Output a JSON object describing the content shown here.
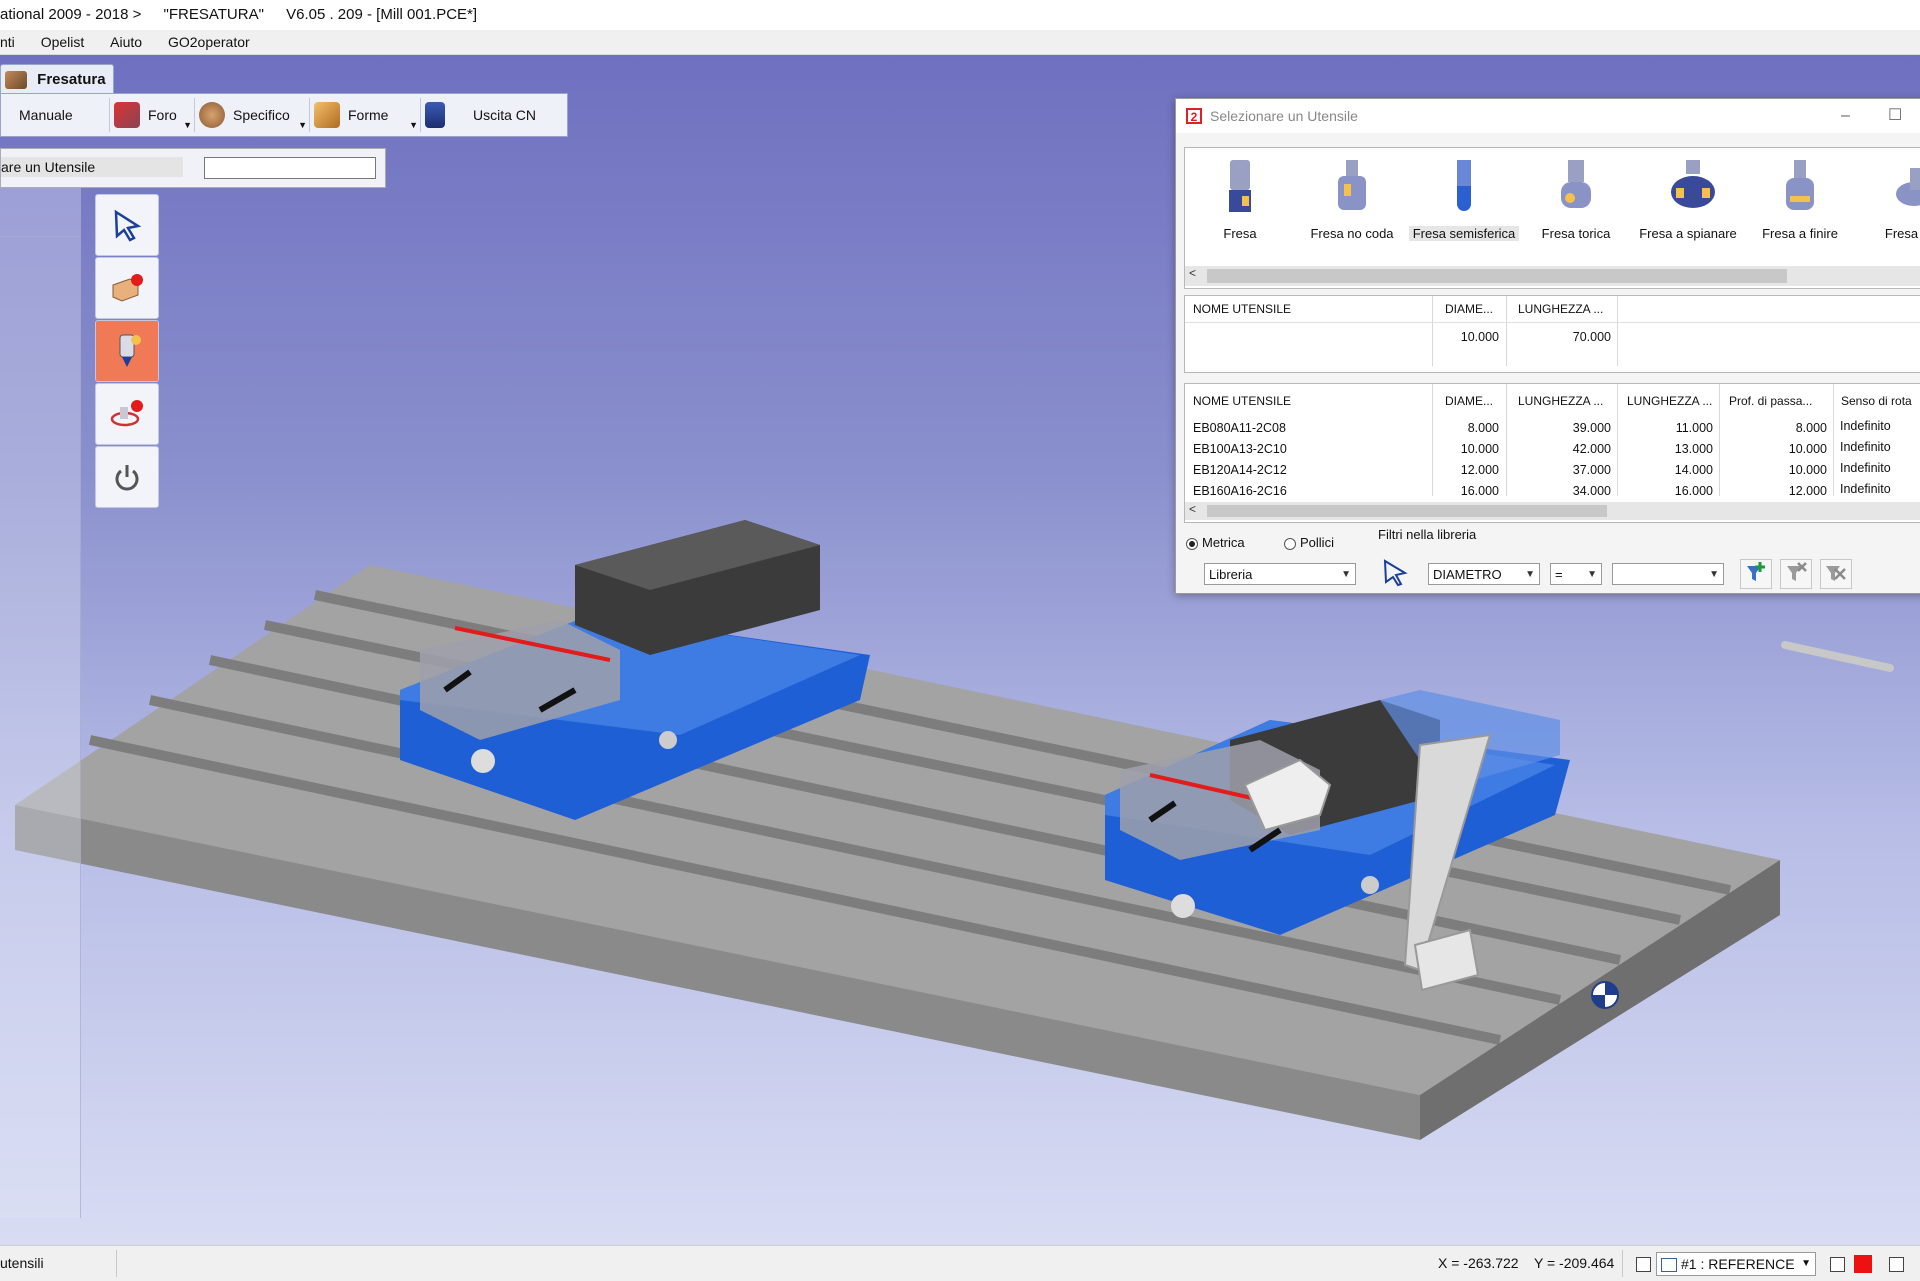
{
  "window": {
    "title_parts": [
      "ational 2009 - 2018 >",
      "\"FRESATURA\"",
      "V6.05 . 209 - [Mill 001.PCE*]"
    ]
  },
  "menu": [
    "nti",
    "Opelist",
    "Aiuto",
    "GO2operator"
  ],
  "module_tab": {
    "label": "Fresatura"
  },
  "ribbon": [
    {
      "label": "Manuale",
      "icon": "manual-icon"
    },
    {
      "label": "Foro",
      "icon": "drill-icon"
    },
    {
      "label": "Specifico",
      "icon": "specific-icon"
    },
    {
      "label": "Forme",
      "icon": "shapes-icon"
    },
    {
      "label": "Uscita CN",
      "icon": "nc-output-icon"
    }
  ],
  "utensile_strip": {
    "label": "are un Utensile",
    "value": ""
  },
  "side_tools": [
    "select-arrow-icon",
    "workpiece-icon",
    "tool-icon",
    "toolpath-icon",
    "power-icon"
  ],
  "dialog": {
    "title": "Selezionare un Utensile",
    "tool_types": [
      "Fresa",
      "Fresa no coda",
      "Fresa semisferica",
      "Fresa torica",
      "Fresa a spianare",
      "Fresa a finire",
      "Fresa a c"
    ],
    "selected_tool_type": "Fresa semisferica",
    "filter_grid": {
      "headers": [
        "NOME UTENSILE",
        "DIAME...",
        "LUNGHEZZA ..."
      ],
      "row": [
        "",
        "10.000",
        "70.000"
      ]
    },
    "tools_grid": {
      "headers": [
        "NOME UTENSILE",
        "DIAME...",
        "LUNGHEZZA ...",
        "LUNGHEZZA ...",
        "Prof. di passa...",
        "Senso di rota"
      ],
      "rows": [
        [
          "EB080A11-2C08",
          "8.000",
          "39.000",
          "11.000",
          "8.000",
          "Indefinito"
        ],
        [
          "EB100A13-2C10",
          "10.000",
          "42.000",
          "13.000",
          "10.000",
          "Indefinito"
        ],
        [
          "EB120A14-2C12",
          "12.000",
          "37.000",
          "14.000",
          "10.000",
          "Indefinito"
        ],
        [
          "EB160A16-2C16",
          "16.000",
          "34.000",
          "16.000",
          "12.000",
          "Indefinito"
        ]
      ]
    },
    "units": {
      "metric": "Metrica",
      "inch": "Pollici",
      "selected": "metric"
    },
    "library_combo": "Libreria",
    "filters_label": "Filtri nella libreria",
    "filter_field": "DIAMETRO",
    "filter_operator": "=",
    "filter_value": ""
  },
  "status": {
    "left": "utensili",
    "x": "X = -263.722",
    "y": "Y = -209.464",
    "reference": "#1 : REFERENCE"
  },
  "colors": {
    "viewport_top": "#6f70c0",
    "viewport_bottom": "#d8dcf3",
    "vise_blue": "#1f5fd6",
    "active_tool": "#f07a55",
    "status_red": "#ee1111"
  }
}
